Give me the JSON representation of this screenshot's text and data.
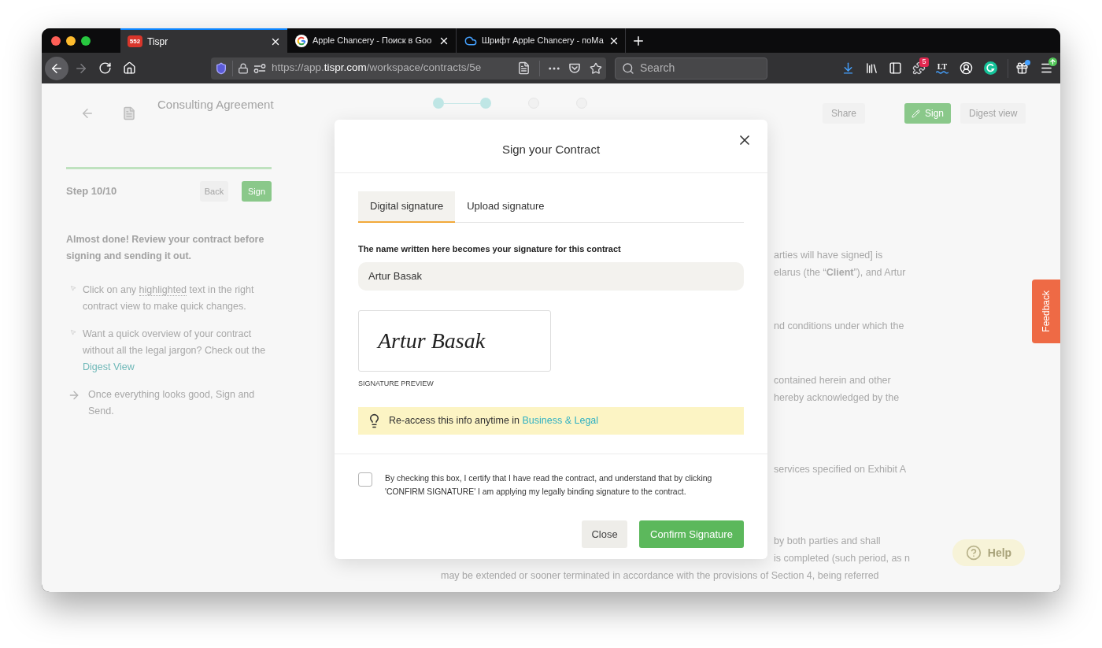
{
  "browser": {
    "tabs": [
      {
        "kind": "app",
        "badge": "552",
        "title": "Tispr",
        "selected": true
      },
      {
        "kind": "search",
        "title": "Apple Chancery - Поиск в Goo",
        "selected": false
      },
      {
        "kind": "cloud",
        "title": "Шрифт Apple Chancery - поМа",
        "selected": false
      }
    ],
    "address": {
      "prefix": "https://app.",
      "domain": "tispr.com",
      "path": "/workspace/contracts/5e"
    },
    "search": {
      "placeholder": "Search"
    },
    "addon_badge": "5",
    "addon_label": "LT"
  },
  "page": {
    "header": {
      "title": "Consulting Agreement",
      "steps": [
        {
          "completed": true
        },
        {
          "completed": true
        },
        {
          "completed": false
        },
        {
          "completed": false
        }
      ],
      "actions": [
        {
          "kind": "plain",
          "label": "Share"
        },
        {
          "kind": "primary",
          "label": "Sign"
        },
        {
          "kind": "plain",
          "label": "Digest view"
        }
      ]
    },
    "wizard": {
      "progress": {
        "level": 1
      },
      "step": "Step 10/10",
      "buttons": [
        {
          "kind": "secondary",
          "label": "Back"
        },
        {
          "kind": "primary",
          "label": "Sign"
        }
      ],
      "intro": "Almost done! Review your contract before signing and sending it out.",
      "tips": [
        {
          "kind": "pointer",
          "before": "Click on any ",
          "highlight": "highlighted",
          "after": " text in the right contract view to make quick changes."
        },
        {
          "kind": "pointer",
          "before": "Want a quick overview of your contract without all the legal jargon? Check out the ",
          "link": "Digest View"
        },
        {
          "kind": "arrow",
          "before": "Once everything looks good, Sign and Send."
        }
      ]
    },
    "document": {
      "paragraphs": [
        {
          "lines": [
            {
              "kind": "partial",
              "text": "arties will have signed] is"
            },
            {
              "kind": "partial",
              "text": "elarus (the “**Client**”), and Artur"
            }
          ]
        },
        {
          "lines": [
            {
              "kind": "partial",
              "text": "nd conditions under which the"
            }
          ]
        },
        {
          "lines": [
            {
              "kind": "partial",
              "text": "contained herein and other"
            },
            {
              "kind": "partial",
              "text": "hereby acknowledged by the"
            }
          ]
        },
        {
          "lines": [
            {
              "kind": "partial",
              "text": "services specified on Exhibit A"
            }
          ]
        },
        {
          "lines": [
            {
              "kind": "partial",
              "text": "by both parties and shall"
            },
            {
              "kind": "partial",
              "text": "is completed (such period, as n"
            },
            {
              "kind": "full",
              "text": "may be extended or sooner terminated in accordance with the provisions of Section 4, being referred"
            }
          ]
        }
      ]
    },
    "feedback": "Feedback",
    "help": "Help"
  },
  "dialog": {
    "title": "Sign your Contract",
    "tabs": [
      {
        "label": "Digital signature",
        "selected": true
      },
      {
        "label": "Upload signature",
        "selected": false
      }
    ],
    "name_field": {
      "label": "The name written here becomes your signature for this contract",
      "value": "Artur Basak"
    },
    "preview": {
      "signature": "Artur Basak",
      "caption": "SIGNATURE PREVIEW"
    },
    "info": {
      "text": "Re-access this info anytime in ",
      "link": "Business & Legal"
    },
    "consent": {
      "checked": false,
      "text": "By checking this box, I certify that I have read the contract, and understand that by clicking 'CONFIRM SIGNATURE' I am applying my legally binding signature to the contract."
    },
    "buttons": [
      {
        "kind": "secondary",
        "label": "Close"
      },
      {
        "kind": "primary",
        "label": "Confirm Signature"
      }
    ]
  }
}
